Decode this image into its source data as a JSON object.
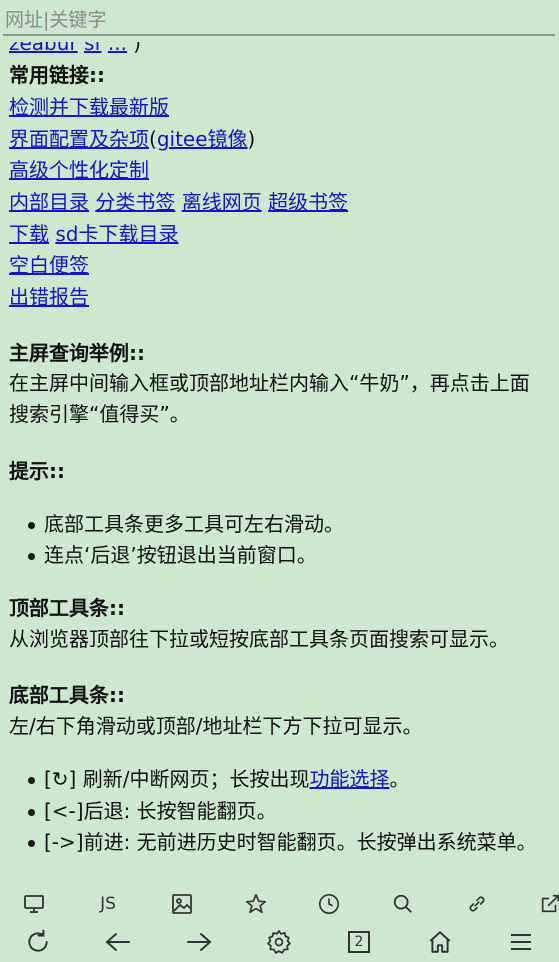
{
  "address": {
    "placeholder": "网址|关键字"
  },
  "content": {
    "cut_links": [
      "zeabur",
      "sf",
      "..."
    ],
    "cut_close": ")",
    "common_links_heading": "常用链接::",
    "links": {
      "check_update": "检测并下载最新版",
      "ui_config": "界面配置及杂项",
      "gitee_open": "(",
      "gitee": "gitee镜像",
      "gitee_close": ")",
      "advanced": "高级个性化定制",
      "inner_dir": "内部目录",
      "bookmarks": "分类书签",
      "offline": "离线网页",
      "super_bookmarks": "超级书签",
      "download": "下载",
      "sd_download": "sd卡下载目录",
      "blank_note": "空白便签",
      "report": "出错报告"
    },
    "home_query_heading": "主屏查询举例::",
    "home_query_text": "在主屏中间输入框或顶部地址栏内输入“牛奶”，再点击上面搜索引擎“值得买”。",
    "tips_heading": "提示::",
    "tips": [
      "底部工具条更多工具可左右滑动。",
      "连点‘后退’按钮退出当前窗口。"
    ],
    "top_toolbar_heading": "顶部工具条::",
    "top_toolbar_text": "从浏览器顶部往下拉或短按底部工具条页面搜索可显示。",
    "bottom_toolbar_heading": "底部工具条::",
    "bottom_toolbar_text": "左/右下角滑动或顶部/地址栏下方下拉可显示。",
    "bottom_items": {
      "refresh_prefix": "[↻] 刷新/中断网页；长按出现",
      "refresh_link": "功能选择",
      "refresh_suffix": "。",
      "back": "[<-]后退: 长按智能翻页。",
      "forward": "[->]前进: 无前进历史时智能翻页。长按弹出系统菜单。"
    }
  },
  "toolbar": {
    "js_label": "JS",
    "tab_count": "2",
    "top_icons": [
      "desktop-icon",
      "js-icon",
      "image-icon",
      "star-icon",
      "history-icon",
      "search-icon",
      "link-icon",
      "external-link-icon"
    ],
    "bottom_icons": [
      "refresh-icon",
      "back-arrow-icon",
      "forward-arrow-icon",
      "settings-icon",
      "tab-count-icon",
      "home-icon",
      "menu-icon"
    ]
  }
}
